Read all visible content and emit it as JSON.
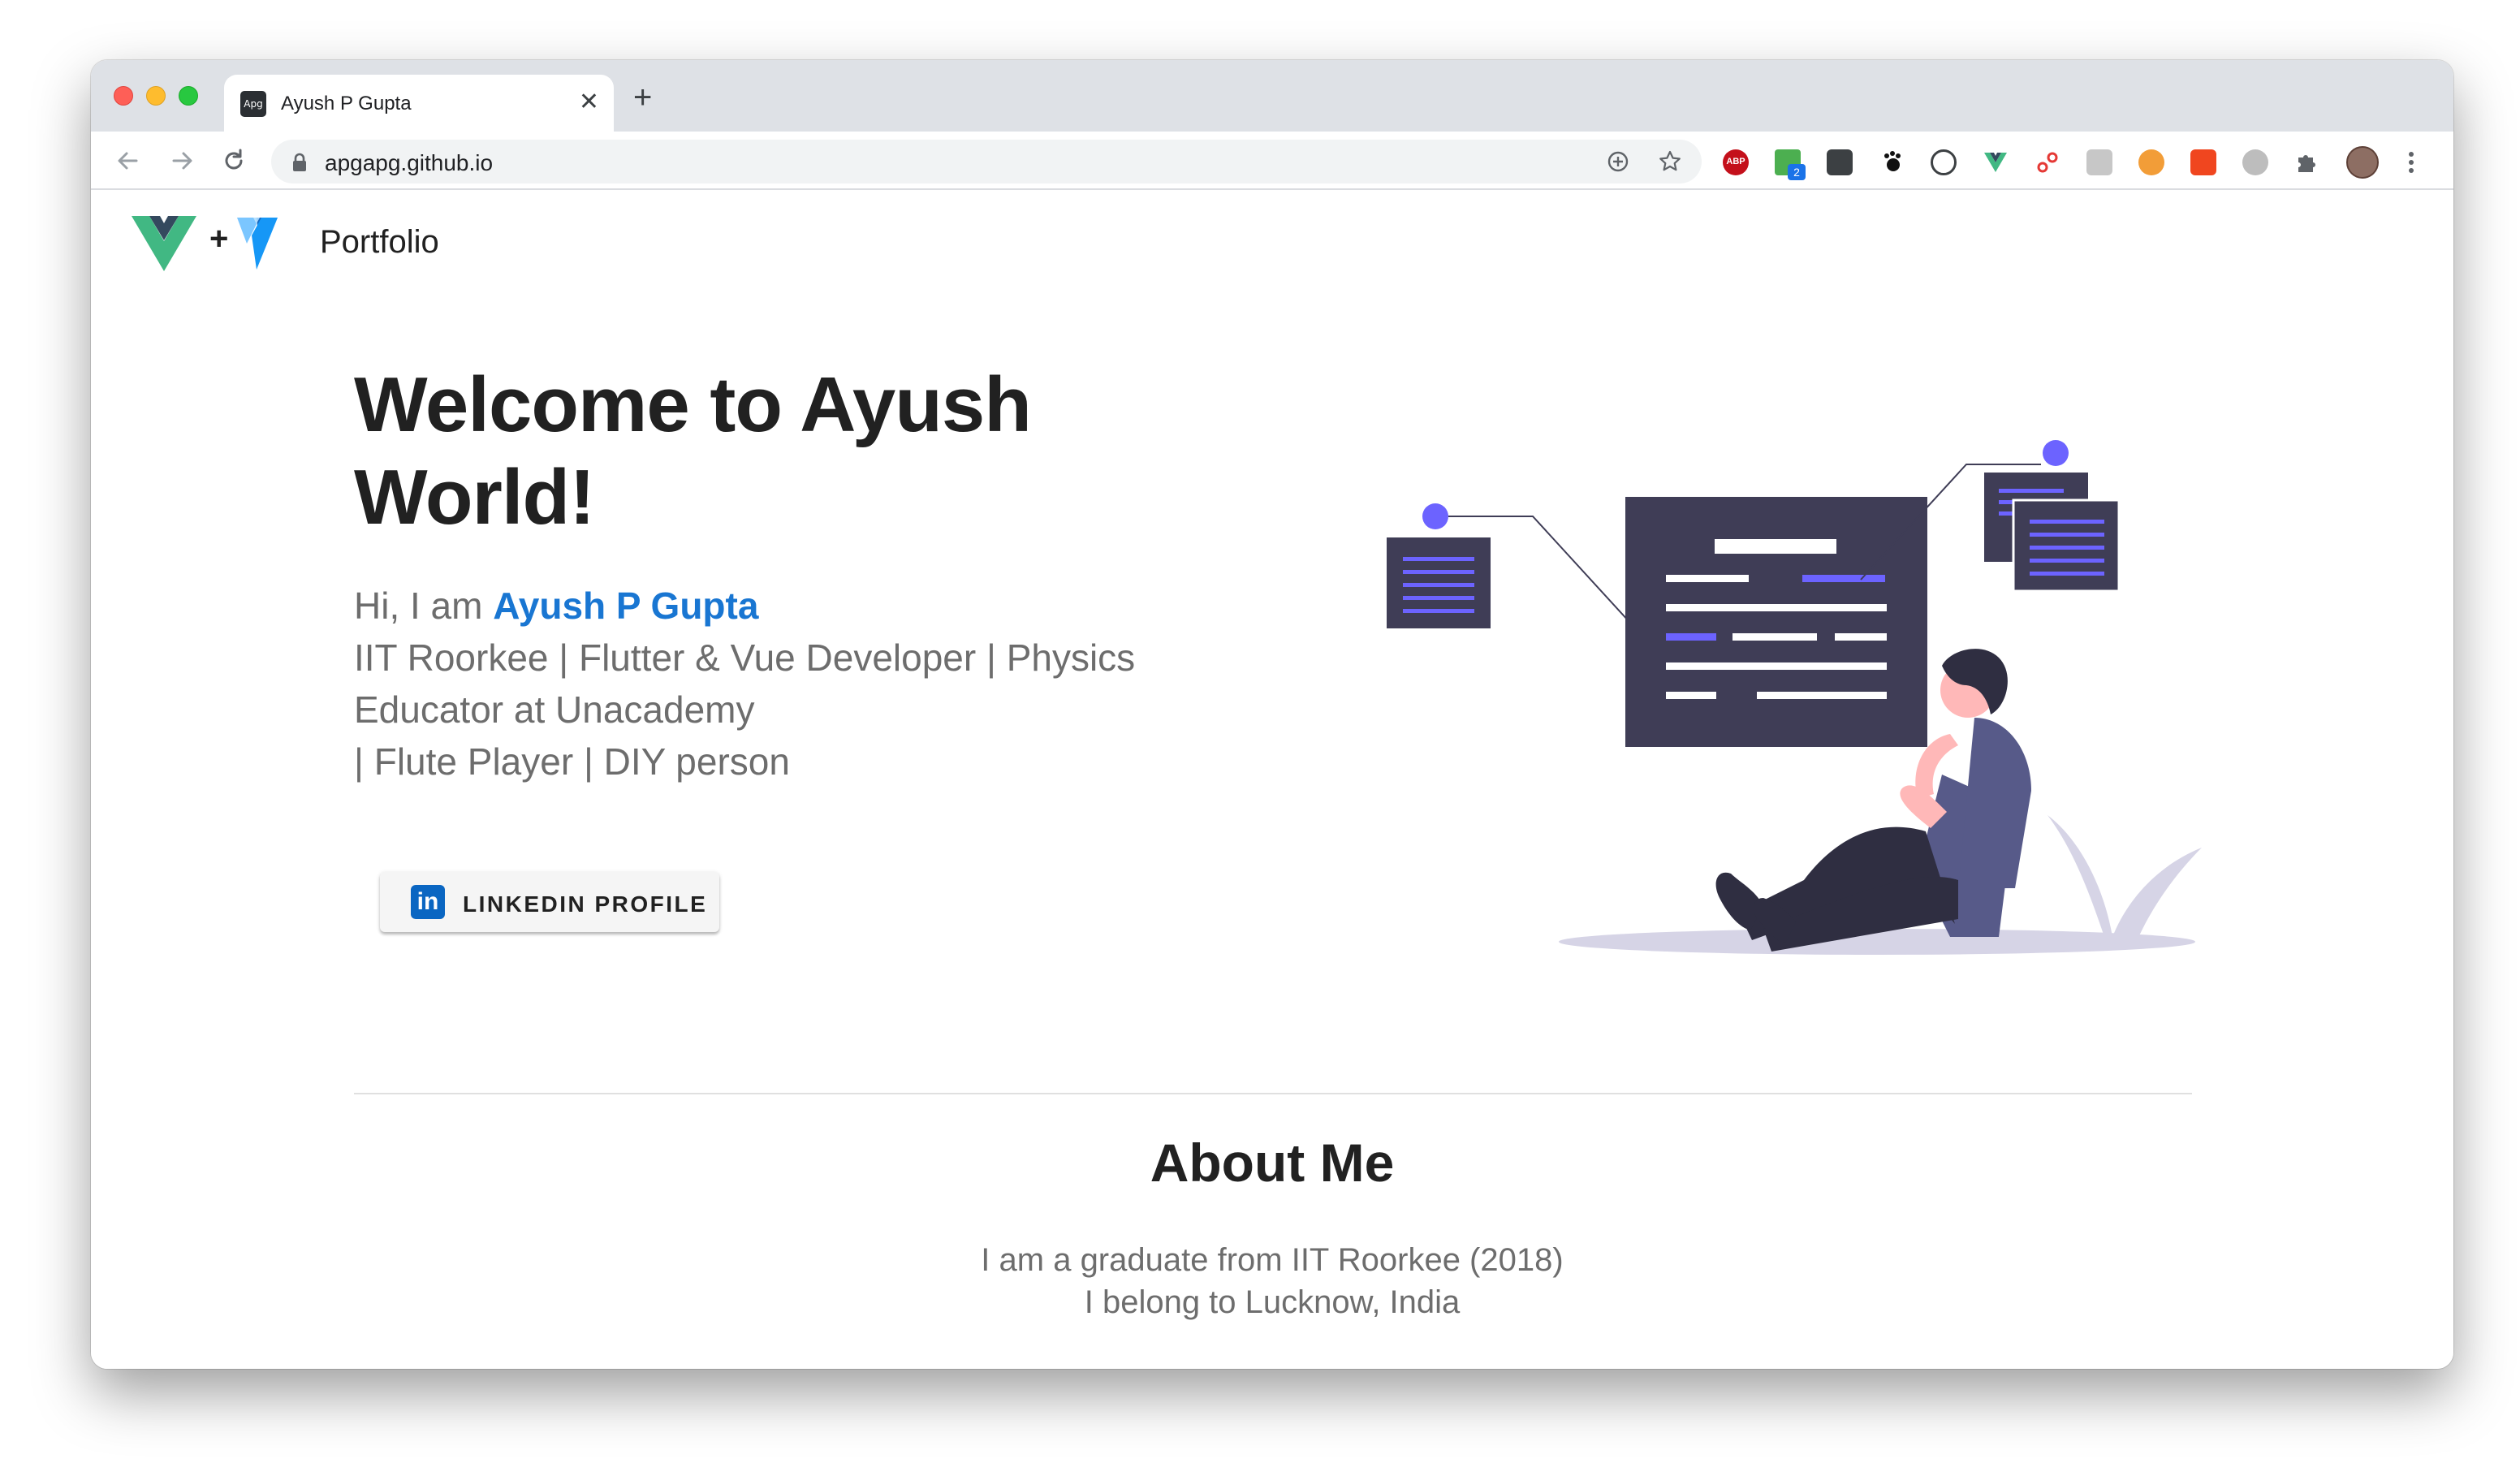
{
  "browser": {
    "tab_title": "Ayush P Gupta",
    "tab_favicon_text": "Apg",
    "close_label": "✕",
    "new_tab_label": "+",
    "url": "apgapg.github.io"
  },
  "extensions": {
    "abp_label": "ABP",
    "badge_label": "2"
  },
  "header": {
    "brand": "Portfolio",
    "plus": "+"
  },
  "hero": {
    "title": "Welcome to Ayush World!",
    "intro_prefix": "Hi, I am ",
    "intro_name": "Ayush P Gupta",
    "line1": "IIT Roorkee | Flutter & Vue Developer | Physics",
    "line2": "Educator at Unacademy",
    "line3": "| Flute Player | DIY person",
    "linkedin_icon_text": "in",
    "linkedin_label": "LINKEDIN PROFILE"
  },
  "about": {
    "title": "About Me",
    "line1": "I am a graduate from IIT Roorkee (2018)",
    "line2": "I belong to Lucknow, India"
  },
  "colors": {
    "accent": "#6c63ff",
    "dark": "#3f3d56",
    "link": "#1976d2",
    "vue_green": "#41b883",
    "vue_dark": "#34495e"
  }
}
